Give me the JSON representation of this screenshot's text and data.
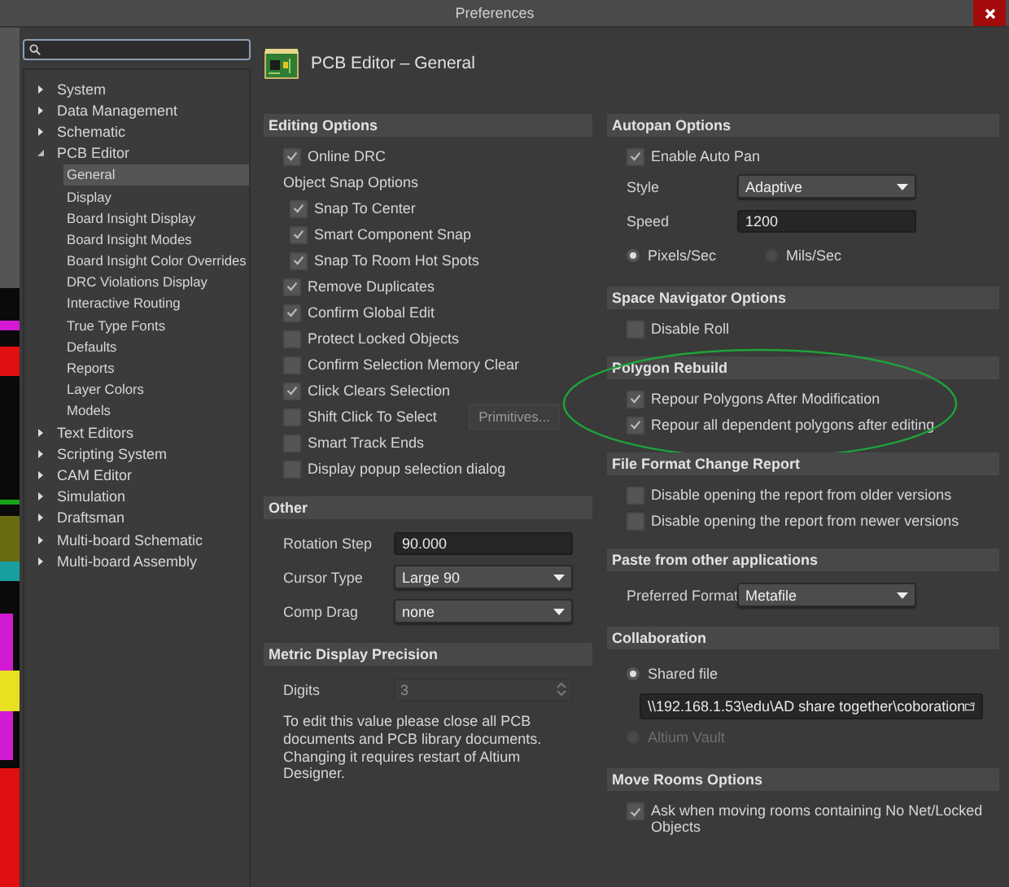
{
  "window": {
    "title": "Preferences"
  },
  "tree": [
    {
      "label": "System",
      "expanded": false
    },
    {
      "label": "Data Management",
      "expanded": false
    },
    {
      "label": "Schematic",
      "expanded": false
    },
    {
      "label": "PCB Editor",
      "expanded": true,
      "children": [
        {
          "label": "General",
          "selected": true
        },
        {
          "label": "Display",
          "selected": false
        },
        {
          "label": "Board Insight Display",
          "selected": false
        },
        {
          "label": "Board Insight Modes",
          "selected": false
        },
        {
          "label": "Board Insight Color Overrides",
          "selected": false
        },
        {
          "label": "DRC Violations Display",
          "selected": false
        },
        {
          "label": "Interactive Routing",
          "selected": false
        },
        {
          "label": "True Type Fonts",
          "selected": false
        },
        {
          "label": "Defaults",
          "selected": false
        },
        {
          "label": "Reports",
          "selected": false
        },
        {
          "label": "Layer Colors",
          "selected": false
        },
        {
          "label": "Models",
          "selected": false
        }
      ]
    },
    {
      "label": "Text Editors",
      "expanded": false
    },
    {
      "label": "Scripting System",
      "expanded": false
    },
    {
      "label": "CAM Editor",
      "expanded": false
    },
    {
      "label": "Simulation",
      "expanded": false
    },
    {
      "label": "Draftsman",
      "expanded": false
    },
    {
      "label": "Multi-board Schematic",
      "expanded": false
    },
    {
      "label": "Multi-board Assembly",
      "expanded": false
    }
  ],
  "page": {
    "title": "PCB Editor – General"
  },
  "left_column": [
    {
      "title": "Editing Options",
      "highlighted": false,
      "rows": [
        {
          "kind": "check",
          "label": "Online DRC",
          "checked": true
        },
        {
          "kind": "group",
          "label": "Object Snap Options",
          "children": [
            {
              "kind": "check",
              "label": "Snap To Center",
              "checked": true
            },
            {
              "kind": "check",
              "label": "Smart Component Snap",
              "checked": true
            },
            {
              "kind": "check",
              "label": "Snap To Room Hot Spots",
              "checked": true
            }
          ]
        },
        {
          "kind": "check",
          "label": "Remove Duplicates",
          "checked": true
        },
        {
          "kind": "check",
          "label": "Confirm Global Edit",
          "checked": true
        },
        {
          "kind": "check",
          "label": "Protect Locked Objects",
          "checked": false
        },
        {
          "kind": "check",
          "label": "Confirm Selection Memory Clear",
          "checked": false
        },
        {
          "kind": "check",
          "label": "Click Clears Selection",
          "checked": true
        },
        {
          "kind": "check",
          "label": "Shift Click To Select",
          "checked": false,
          "button": {
            "label": "Primitives...",
            "disabled": true
          }
        },
        {
          "kind": "check",
          "label": "Smart Track Ends",
          "checked": false
        },
        {
          "kind": "check",
          "label": "Display popup selection dialog",
          "checked": false
        }
      ]
    },
    {
      "title": "Other",
      "highlighted": false,
      "rows": [
        {
          "kind": "field",
          "label": "Rotation Step",
          "value": "90.000"
        },
        {
          "kind": "dropdown",
          "label": "Cursor Type",
          "value": "Large 90"
        },
        {
          "kind": "dropdown",
          "label": "Comp Drag",
          "value": "none"
        }
      ]
    },
    {
      "title": "Metric Display Precision",
      "highlighted": false,
      "rows": [
        {
          "kind": "spin",
          "label": "Digits",
          "value": "3",
          "disabled": true
        },
        {
          "kind": "note",
          "text": "To edit this value please close all PCB documents and PCB library documents. Changing it requires restart of Altium Designer."
        }
      ]
    }
  ],
  "right_column": [
    {
      "title": "Autopan Options",
      "highlighted": false,
      "rows": [
        {
          "kind": "check",
          "label": "Enable Auto Pan",
          "checked": true
        },
        {
          "kind": "dropdown",
          "label": "Style",
          "value": "Adaptive"
        },
        {
          "kind": "field",
          "label": "Speed",
          "value": "1200"
        },
        {
          "kind": "radios",
          "options": [
            {
              "label": "Pixels/Sec",
              "selected": true
            },
            {
              "label": "Mils/Sec",
              "selected": false
            }
          ]
        }
      ]
    },
    {
      "title": "Space Navigator Options",
      "highlighted": false,
      "rows": [
        {
          "kind": "check",
          "label": "Disable Roll",
          "checked": false
        }
      ]
    },
    {
      "title": "Polygon Rebuild",
      "highlighted": true,
      "rows": [
        {
          "kind": "check",
          "label": "Repour Polygons After Modification",
          "checked": true
        },
        {
          "kind": "check",
          "label": "Repour all dependent polygons after editing",
          "checked": true
        }
      ]
    },
    {
      "title": "File Format Change Report",
      "highlighted": false,
      "rows": [
        {
          "kind": "check",
          "label": "Disable opening the report from older versions",
          "checked": false
        },
        {
          "kind": "check",
          "label": "Disable opening the report from newer versions",
          "checked": false
        }
      ]
    },
    {
      "title": "Paste from other applications",
      "highlighted": false,
      "rows": [
        {
          "kind": "dropdown",
          "label": "Preferred Format",
          "value": "Metafile"
        }
      ]
    },
    {
      "title": "Collaboration",
      "highlighted": false,
      "rows": [
        {
          "kind": "radio",
          "label": "Shared file",
          "selected": true,
          "disabled": false
        },
        {
          "kind": "path",
          "value": "\\\\192.168.1.53\\edu\\AD share together\\coboration"
        },
        {
          "kind": "radio",
          "label": "Altium Vault",
          "selected": false,
          "disabled": true
        }
      ]
    },
    {
      "title": "Move Rooms Options",
      "highlighted": false,
      "rows": [
        {
          "kind": "check",
          "label": "Ask when moving rooms containing No Net/Locked Objects",
          "checked": true
        }
      ]
    }
  ]
}
